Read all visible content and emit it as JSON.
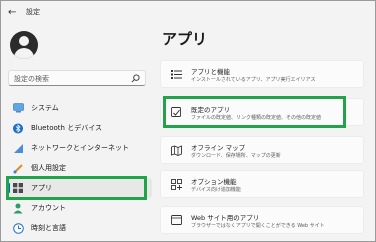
{
  "window": {
    "title": "設定",
    "back_icon": "back-arrow-icon"
  },
  "sidebar": {
    "search_placeholder": "設定の検索",
    "items": [
      {
        "label": "システム",
        "icon": "monitor-icon"
      },
      {
        "label": "Bluetooth とデバイス",
        "icon": "bluetooth-icon"
      },
      {
        "label": "ネットワークとインターネット",
        "icon": "network-icon"
      },
      {
        "label": "個人用設定",
        "icon": "brush-icon"
      },
      {
        "label": "アプリ",
        "icon": "apps-icon",
        "selected": true
      },
      {
        "label": "アカウント",
        "icon": "account-icon"
      },
      {
        "label": "時刻と言語",
        "icon": "time-language-icon"
      }
    ]
  },
  "main": {
    "title": "アプリ",
    "cards": [
      {
        "title": "アプリと機能",
        "subtitle": "インストールされているアプリ、アプリ実行エイリアス",
        "icon": "apps-list-icon"
      },
      {
        "title": "既定のアプリ",
        "subtitle": "ファイルの既定値、リンク種類の既定値、その他の既定値",
        "icon": "default-apps-icon"
      },
      {
        "title": "オフライン マップ",
        "subtitle": "ダウンロード、保存場所、マップの更新",
        "icon": "map-icon"
      },
      {
        "title": "オプション機能",
        "subtitle": "デバイス向け追加機能",
        "icon": "optional-features-icon"
      },
      {
        "title": "Web サイト用のアプリ",
        "subtitle": "ブラウザーではなくアプリで開くことができる Web サイト",
        "icon": "web-apps-icon"
      }
    ]
  },
  "colors": {
    "accent": "#0067c0",
    "highlight": "#21a34a",
    "background": "#f3f3f3"
  }
}
